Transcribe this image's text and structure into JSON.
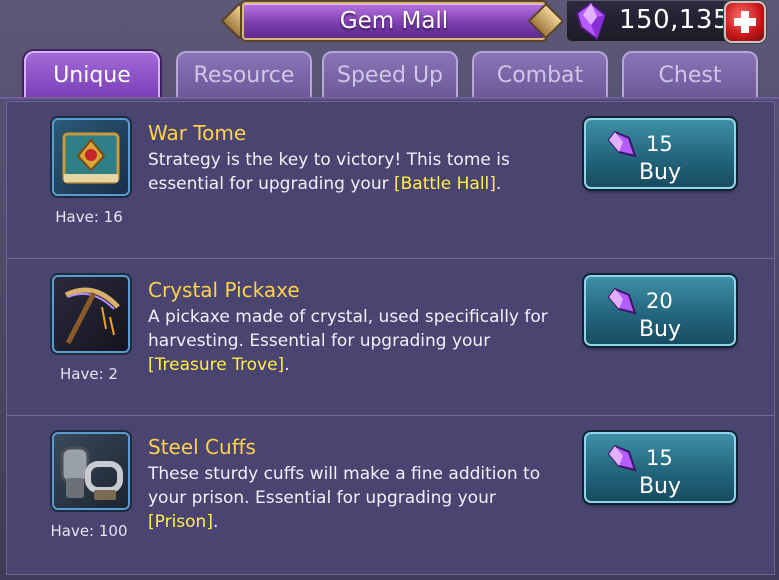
{
  "header": {
    "title": "Gem Mall",
    "gem_balance": "150,135",
    "gem_icon": "purple-gem-icon",
    "add_icon": "plus-icon"
  },
  "tabs": [
    {
      "label": "Unique",
      "active": true
    },
    {
      "label": "Resource",
      "active": false
    },
    {
      "label": "Speed Up",
      "active": false
    },
    {
      "label": "Combat",
      "active": false
    },
    {
      "label": "Chest",
      "active": false
    }
  ],
  "items": [
    {
      "name": "War Tome",
      "desc_text": "Strategy is the key to victory!  This tome is essential for upgrading your ",
      "desc_highlight": "[Battle Hall]",
      "desc_end": ".",
      "have": "Have: 16",
      "price": "15",
      "buy_label": "Buy",
      "icon": "war-tome-icon"
    },
    {
      "name": "Crystal Pickaxe",
      "desc_text": "A pickaxe made of crystal, used specifically for harvesting. Essential for upgrading your ",
      "desc_highlight": "[Treasure Trove]",
      "desc_end": ".",
      "have": "Have: 2",
      "price": "20",
      "buy_label": "Buy",
      "icon": "crystal-pickaxe-icon"
    },
    {
      "name": "Steel Cuffs",
      "desc_text": "These sturdy cuffs will make a fine addition to your prison. Essential for upgrading your ",
      "desc_highlight": "[Prison]",
      "desc_end": ".",
      "have": "Have: 100",
      "price": "15",
      "buy_label": "Buy",
      "icon": "steel-cuffs-icon"
    }
  ],
  "colors": {
    "item_name": "#ffd24a",
    "highlight": "#ffef4a",
    "buy_button": "#21637a",
    "active_tab": "#7b3fb8"
  }
}
